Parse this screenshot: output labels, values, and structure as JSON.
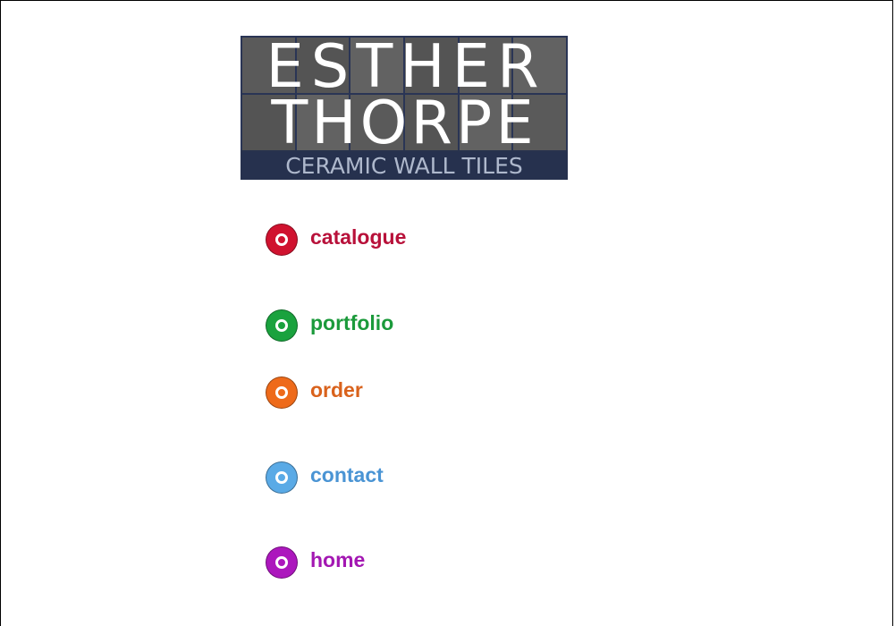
{
  "logo": {
    "line1": "ESTHER",
    "line2": "THORPE",
    "subtitle": "CERAMIC WALL TILES"
  },
  "nav": {
    "items": [
      {
        "label": "catalogue",
        "color": "#c8102e",
        "icon": "circle-bullet-icon"
      },
      {
        "label": "portfolio",
        "color": "#1a9b3c",
        "icon": "circle-bullet-icon"
      },
      {
        "label": "order",
        "color": "#e4621b",
        "icon": "circle-bullet-icon"
      },
      {
        "label": "contact",
        "color": "#4a9fe0",
        "icon": "circle-bullet-icon"
      },
      {
        "label": "home",
        "color": "#a512b8",
        "icon": "circle-bullet-icon"
      }
    ]
  }
}
